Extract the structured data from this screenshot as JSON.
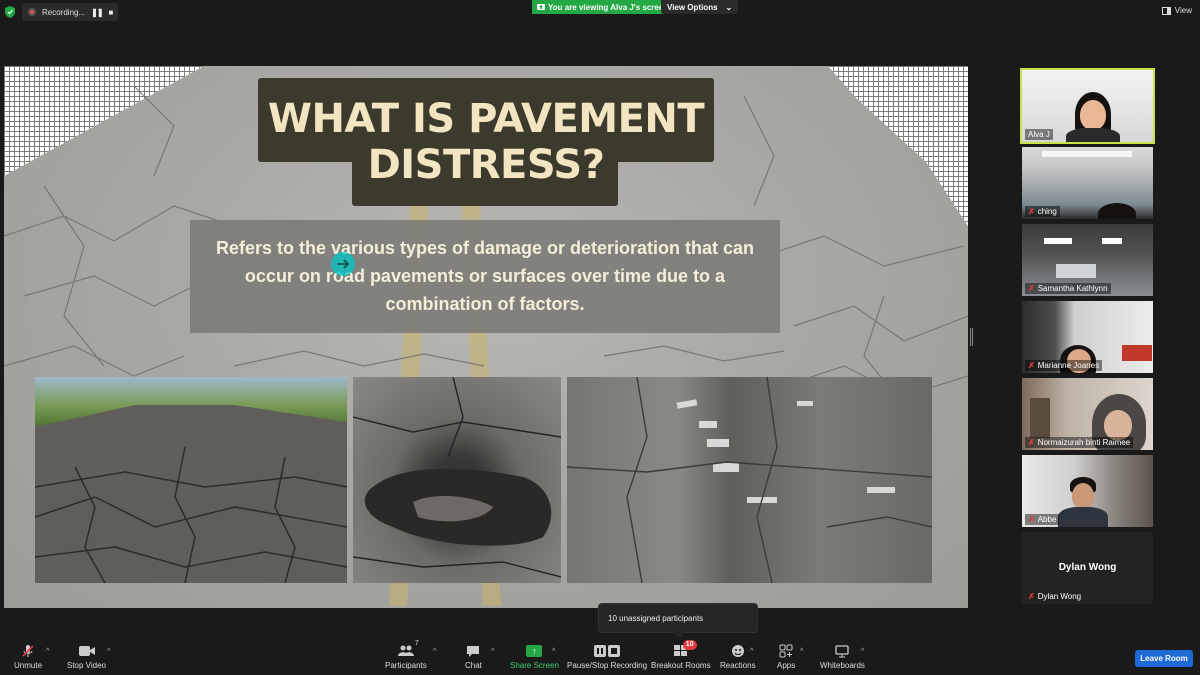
{
  "top_bar": {
    "recording_label": "Recording...",
    "viewing_banner": "You are viewing Alva J's screen",
    "view_options_label": "View Options",
    "view_label": "View"
  },
  "slide": {
    "title_line1": "WHAT IS PAVEMENT",
    "title_line2": "DISTRESS?",
    "definition": "Refers to the various types of damage or deterioration that can occur on road pavements or surfaces over time due to a combination of factors."
  },
  "participants": [
    {
      "name": "Alva J",
      "active": true,
      "muted": false
    },
    {
      "name": "ching",
      "muted": true
    },
    {
      "name": "Samantha Kathlynn",
      "muted": true
    },
    {
      "name": "Marianne Joanes",
      "muted": true
    },
    {
      "name": "Normaizurah binti Raimee",
      "muted": true
    },
    {
      "name": "Abbe",
      "muted": true
    },
    {
      "name": "Dylan Wong",
      "display_name": "Dylan Wong",
      "muted": true
    }
  ],
  "tooltip": "10 unassigned participants",
  "toolbar": {
    "unmute": "Unmute",
    "stop_video": "Stop Video",
    "participants": "Participants",
    "participants_count": "7",
    "chat": "Chat",
    "share_screen": "Share Screen",
    "pause_stop_recording": "Pause/Stop Recording",
    "breakout_rooms": "Breakout Rooms",
    "breakout_badge": "10",
    "reactions": "Reactions",
    "apps": "Apps",
    "whiteboards": "Whiteboards",
    "leave": "Leave Room"
  },
  "colors": {
    "accent_green": "#23a845",
    "leave_blue": "#1e6ad6",
    "active_speaker_border": "#c8e34a",
    "title_text": "#f3e5c1",
    "title_box": "#3c3a2d"
  },
  "icons": [
    "shield-icon",
    "recording-icon",
    "pause-icon",
    "stop-icon",
    "chevron-down-icon",
    "view-icon",
    "mic-off-icon",
    "video-icon",
    "participants-icon",
    "chat-icon",
    "share-screen-icon",
    "breakout-rooms-icon",
    "reactions-icon",
    "apps-icon",
    "whiteboard-icon"
  ]
}
